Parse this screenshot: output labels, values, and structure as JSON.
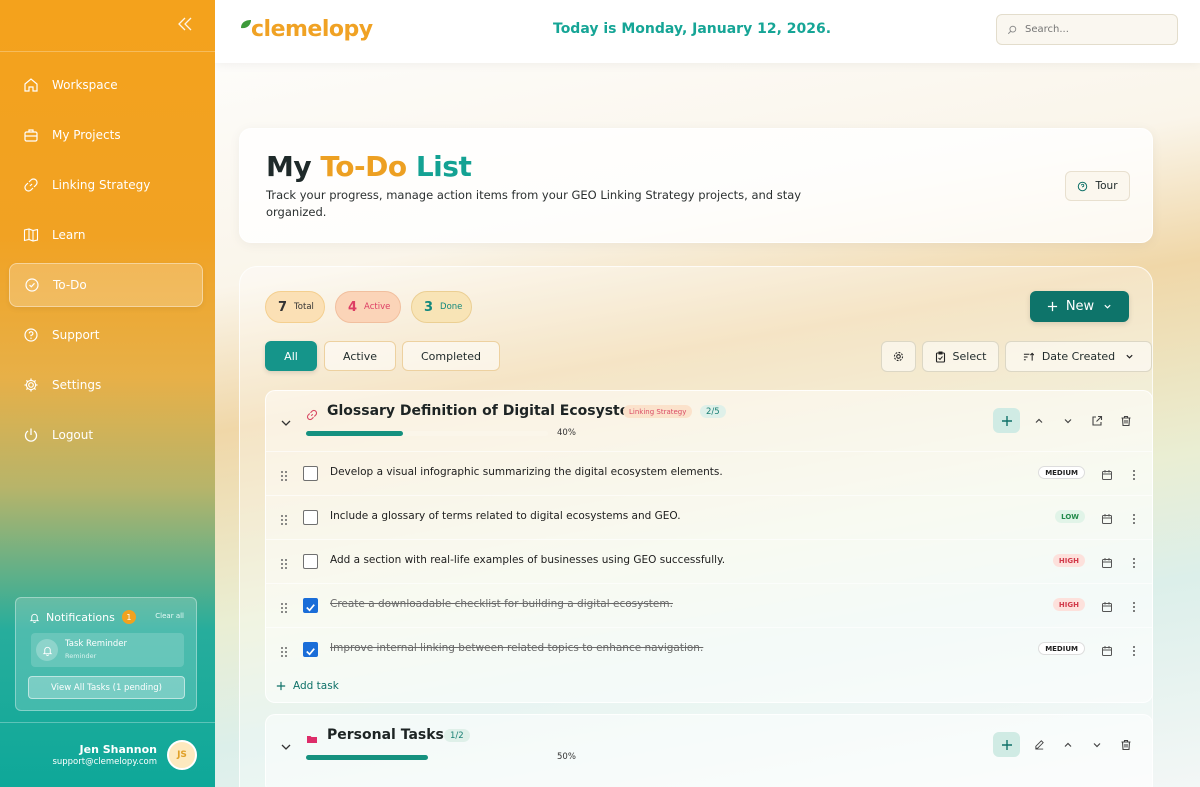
{
  "sidebar": {
    "items": [
      {
        "label": "Workspace",
        "icon": "home-icon"
      },
      {
        "label": "My Projects",
        "icon": "briefcase-icon"
      },
      {
        "label": "Linking Strategy",
        "icon": "link-icon"
      },
      {
        "label": "Learn",
        "icon": "book-icon"
      },
      {
        "label": "To-Do",
        "icon": "check-circle-icon",
        "active": true
      },
      {
        "label": "Support",
        "icon": "help-icon"
      },
      {
        "label": "Settings",
        "icon": "gear-icon"
      },
      {
        "label": "Logout",
        "icon": "power-icon"
      }
    ],
    "notifications": {
      "title": "Notifications",
      "count": "1",
      "clear_label": "Clear all",
      "item_title": "Task Reminder",
      "item_sub": "Reminder",
      "view_all_label": "View All Tasks (1 pending)"
    },
    "user": {
      "name": "Jen Shannon",
      "email": "support@clemelopy.com",
      "initials": "JS"
    }
  },
  "header": {
    "logo": "clemelopy",
    "date_text": "Today is Monday, January 12, 2026.",
    "search_placeholder": "Search..."
  },
  "hero": {
    "title_a": "My",
    "title_b": "To-Do",
    "title_c": "List",
    "description": "Track your progress, manage action items from your GEO Linking Strategy projects, and stay organized.",
    "tour_label": "Tour"
  },
  "stats": {
    "total": {
      "count": "7",
      "label": "Total"
    },
    "active": {
      "count": "4",
      "label": "Active"
    },
    "done": {
      "count": "3",
      "label": "Done"
    }
  },
  "toolbar": {
    "new_label": "New",
    "tabs": [
      "All",
      "Active",
      "Completed"
    ],
    "select_label": "Select",
    "sort_label": "Date Created"
  },
  "groups": [
    {
      "title": "Glossary Definition of Digital Ecosystem",
      "tag": "Linking Strategy",
      "ratio": "2/5",
      "progress": 0.4,
      "progress_label": "40%",
      "tasks": [
        {
          "text": "Develop a visual infographic summarizing the digital ecosystem elements.",
          "priority": "MEDIUM",
          "done": false
        },
        {
          "text": "Include a glossary of terms related to digital ecosystems and GEO.",
          "priority": "LOW",
          "done": false
        },
        {
          "text": "Add a section with real-life examples of businesses using GEO successfully.",
          "priority": "HIGH",
          "done": false
        },
        {
          "text": "Create a downloadable checklist for building a digital ecosystem.",
          "priority": "HIGH",
          "done": true
        },
        {
          "text": "Improve internal linking between related topics to enhance navigation.",
          "priority": "MEDIUM",
          "done": true
        }
      ],
      "add_task_label": "Add task"
    },
    {
      "title": "Personal Tasks",
      "ratio": "1/2",
      "progress": 0.5,
      "progress_label": "50%"
    }
  ],
  "colors": {
    "brand_orange": "#f0a224",
    "brand_teal": "#15958a",
    "new_button": "#0e746a",
    "high": "#d23a4a",
    "low": "#238a4b"
  }
}
